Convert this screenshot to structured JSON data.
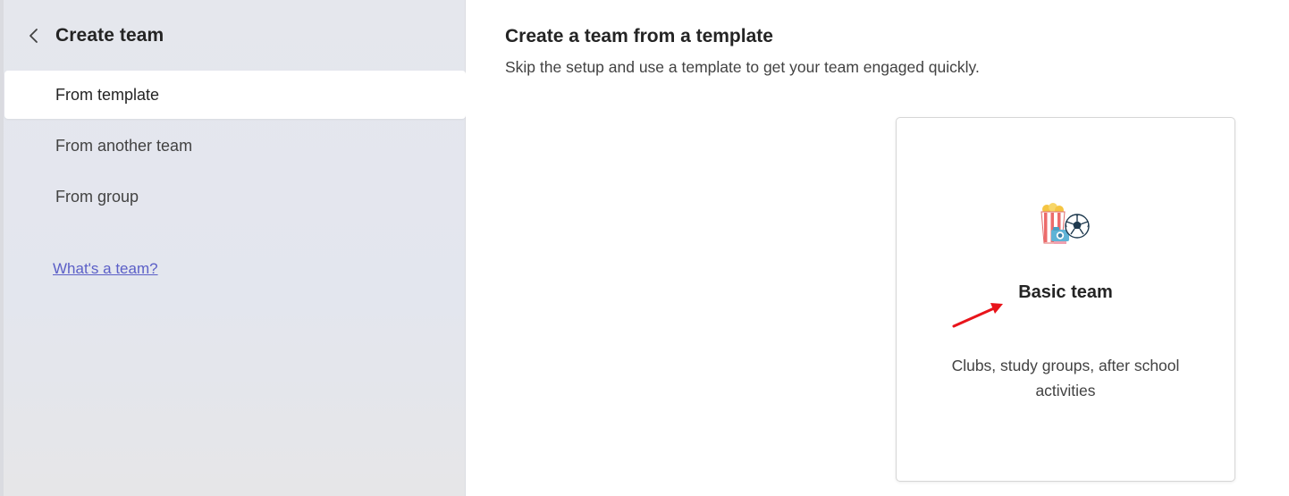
{
  "sidebar": {
    "title": "Create team",
    "back_icon": "chevron-left-icon",
    "items": [
      {
        "label": "From template",
        "selected": true
      },
      {
        "label": "From another team",
        "selected": false
      },
      {
        "label": "From group",
        "selected": false
      }
    ],
    "help_link": "What's a team?"
  },
  "main": {
    "title": "Create a team from a template",
    "subtitle": "Skip the setup and use a template to get your team engaged quickly.",
    "templates": [
      {
        "title": "Basic team",
        "description": "Clubs, study groups, after school activities",
        "icon": "popcorn-camera-soccer-icon"
      }
    ]
  },
  "colors": {
    "accent_link": "#5b5fc7",
    "sidebar_bg": "#e4e7ee",
    "annotation_arrow": "#e8141b"
  }
}
